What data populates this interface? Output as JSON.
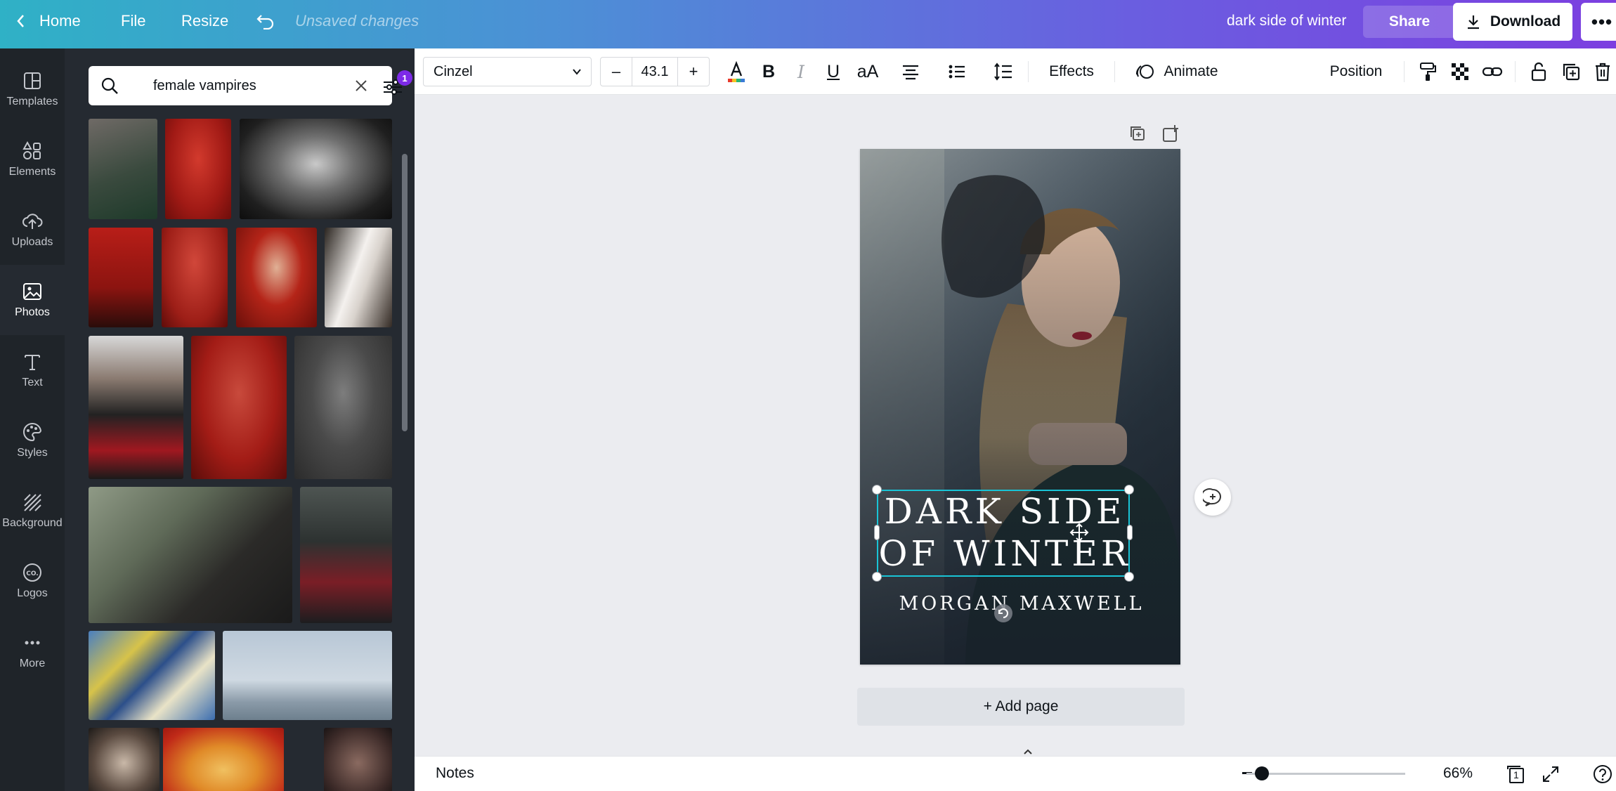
{
  "header": {
    "home": "Home",
    "file": "File",
    "resize": "Resize",
    "status": "Unsaved changes",
    "doc_title": "dark side of winter",
    "share": "Share",
    "download": "Download"
  },
  "rail": {
    "items": [
      {
        "label": "Templates",
        "icon": "templates-icon"
      },
      {
        "label": "Elements",
        "icon": "elements-icon"
      },
      {
        "label": "Uploads",
        "icon": "uploads-icon"
      },
      {
        "label": "Photos",
        "icon": "photos-icon",
        "active": true
      },
      {
        "label": "Text",
        "icon": "text-icon"
      },
      {
        "label": "Styles",
        "icon": "styles-icon"
      },
      {
        "label": "Background",
        "icon": "background-icon"
      },
      {
        "label": "Logos",
        "icon": "logos-icon"
      },
      {
        "label": "More",
        "icon": "more-icon"
      }
    ]
  },
  "search": {
    "value": "female vampires",
    "filter_count": "1"
  },
  "toolbar": {
    "font": "Cinzel",
    "font_size": "43.1",
    "effects": "Effects",
    "animate": "Animate",
    "position": "Position"
  },
  "cover": {
    "title_line1": "DARK SIDE",
    "title_line2": "OF WINTER",
    "author": "MORGAN MAXWELL"
  },
  "canvas": {
    "add_page": "+ Add page"
  },
  "footer": {
    "notes": "Notes",
    "zoom": "66%",
    "zoom_level": 0.66,
    "page_count": "1"
  },
  "colors": {
    "accent": "#7d2ae8",
    "selection": "#19c4d6",
    "rail_bg": "#1f2429",
    "panel_bg": "#252a31"
  }
}
